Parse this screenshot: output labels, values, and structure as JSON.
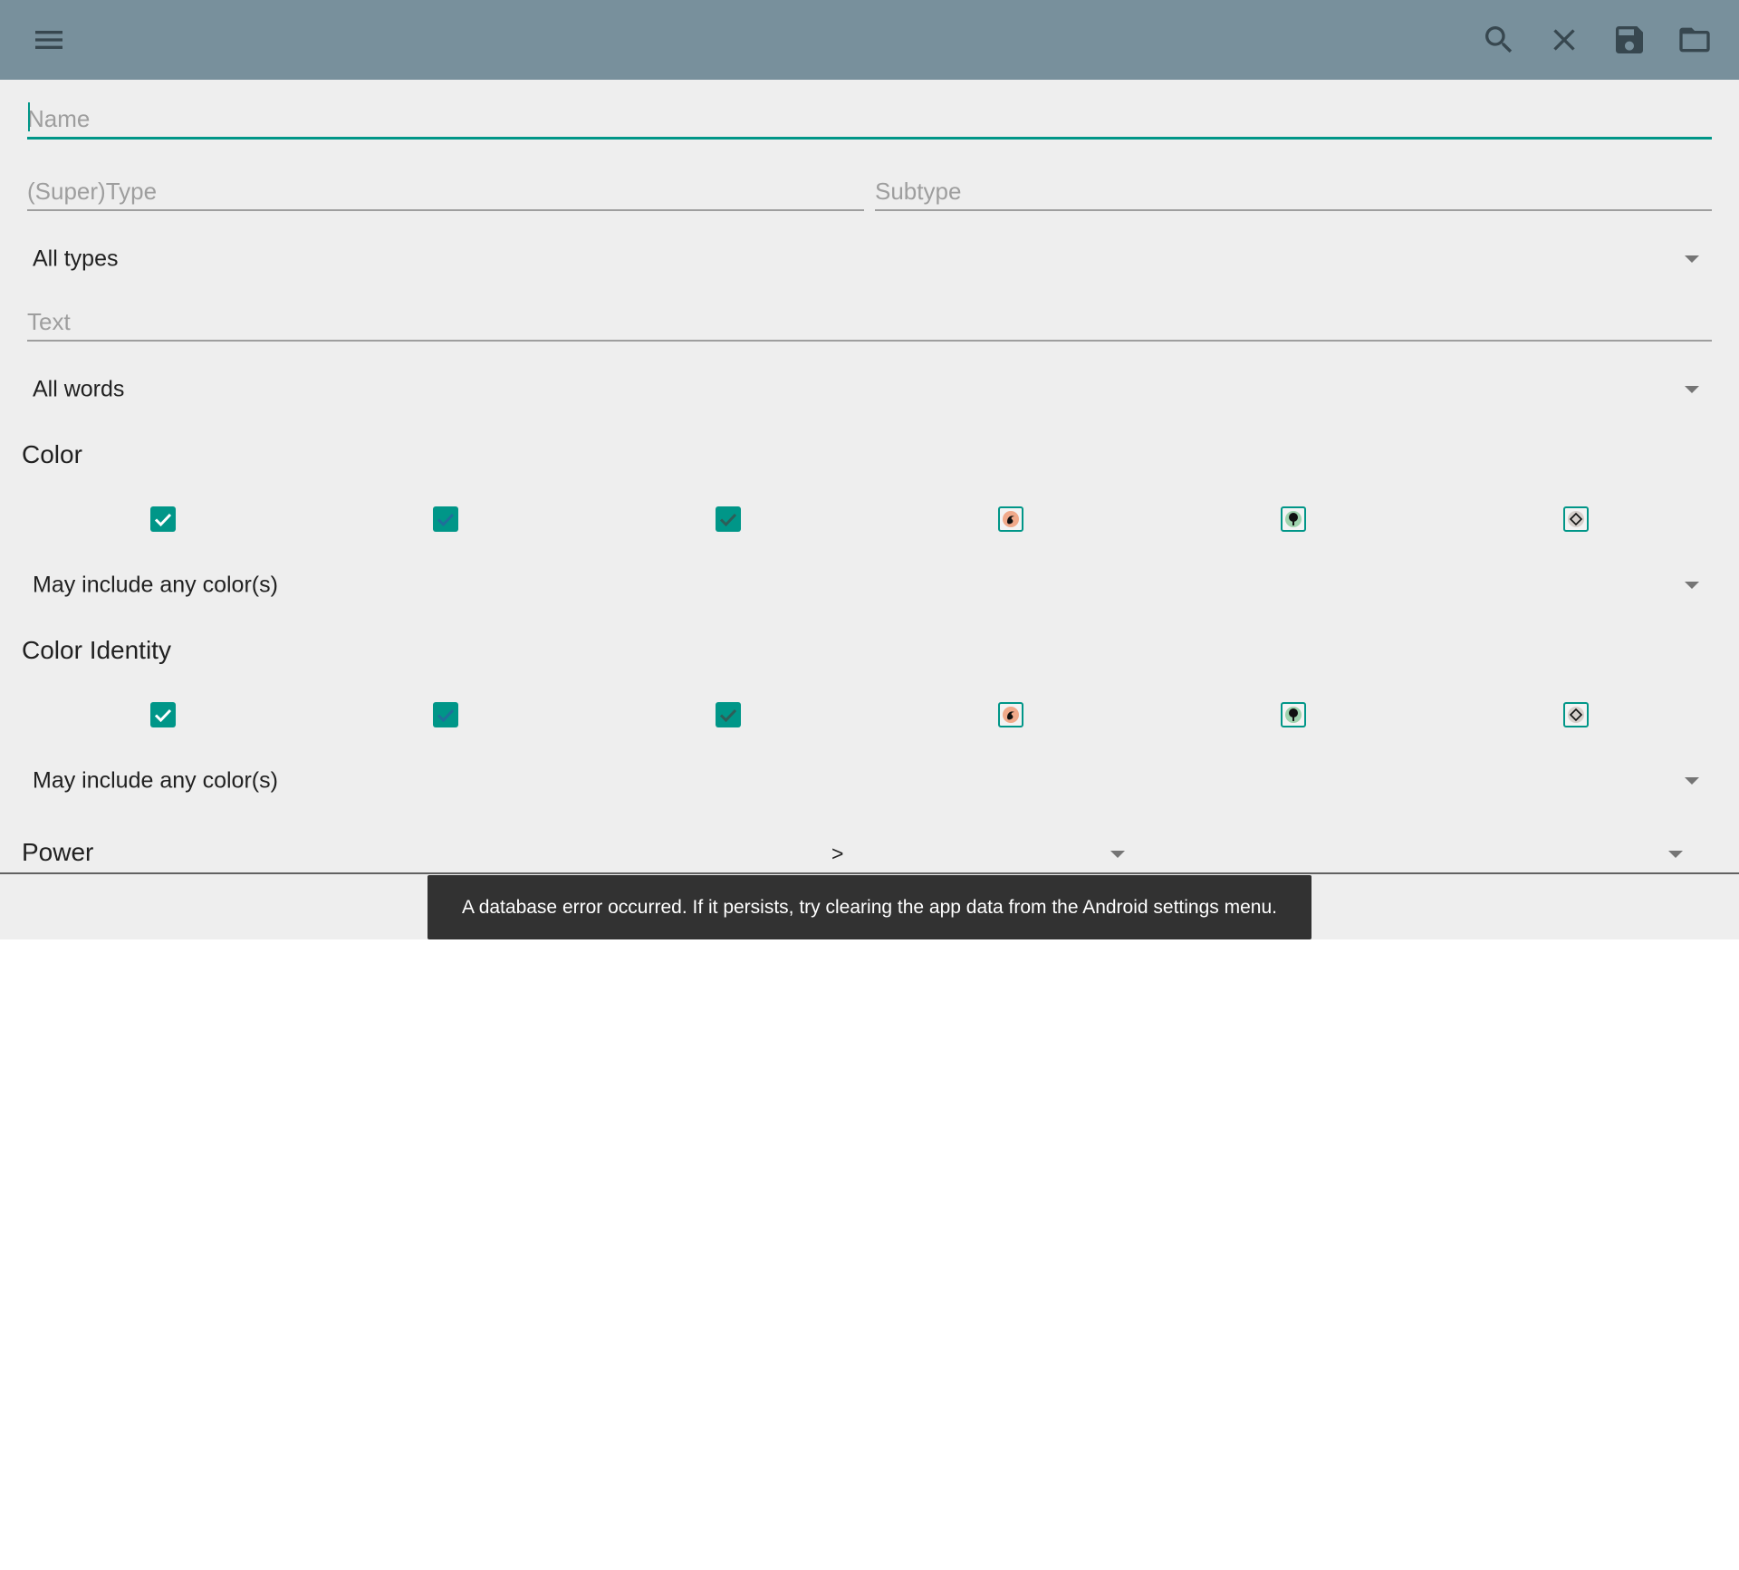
{
  "toolbar": {
    "background": "#78909c",
    "actions": [
      "search-icon",
      "close-icon",
      "save-icon",
      "folder-icon"
    ]
  },
  "fields": {
    "name_placeholder": "Name",
    "name_value": "",
    "supertype_placeholder": "(Super)Type",
    "subtype_placeholder": "Subtype",
    "text_placeholder": "Text"
  },
  "spinners": {
    "type_filter": "All types",
    "text_logic": "All words",
    "color_logic": "May include any color(s)",
    "identity_logic": "May include any color(s)"
  },
  "sections": {
    "color": "Color",
    "color_identity": "Color Identity",
    "power": "Power"
  },
  "color_checkboxes": [
    {
      "symbol": "white",
      "checked": true
    },
    {
      "symbol": "blue",
      "checked": true
    },
    {
      "symbol": "black",
      "checked": true
    },
    {
      "symbol": "red",
      "checked": false
    },
    {
      "symbol": "green",
      "checked": false
    },
    {
      "symbol": "colorless",
      "checked": false
    }
  ],
  "power": {
    "comparison": ">",
    "value": ""
  },
  "snackbar": {
    "message": "A database error occurred. If it persists, try clearing the app data from the Android settings menu."
  },
  "colors": {
    "accent": "#009688",
    "app_background": "#eeeeee",
    "snackbar": "#323232"
  }
}
